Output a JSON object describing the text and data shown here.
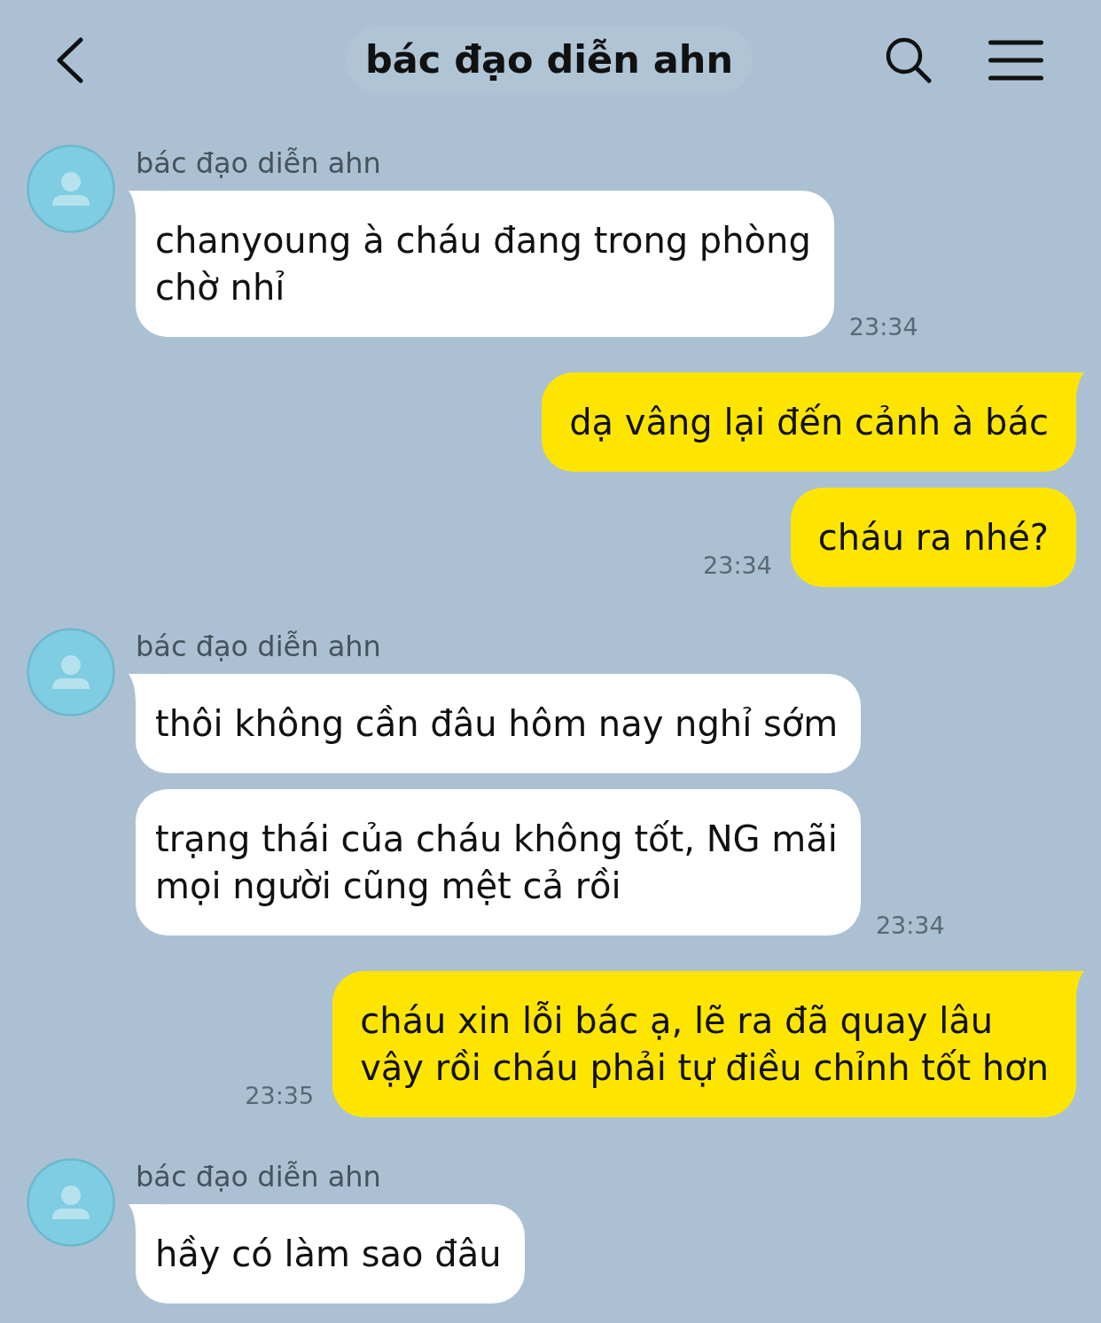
{
  "header": {
    "title": "bác đạo diễn ahn"
  },
  "messages": [
    {
      "kind": "received",
      "sender": "bác đạo diễn ahn",
      "bubbles": [
        {
          "lines": [
            "chanyoung à cháu đang trong phòng",
            "chờ nhỉ"
          ]
        }
      ],
      "time": "23:34"
    },
    {
      "kind": "sent",
      "bubbles": [
        {
          "lines": [
            "dạ vâng lại đến cảnh à bác"
          ]
        },
        {
          "lines": [
            "cháu ra nhé?"
          ]
        }
      ],
      "time": "23:34"
    },
    {
      "kind": "received",
      "sender": "bác đạo diễn ahn",
      "bubbles": [
        {
          "lines": [
            "thôi không cần đâu hôm nay nghỉ sớm"
          ]
        },
        {
          "lines": [
            "trạng thái của cháu không tốt, NG mãi",
            "mọi người cũng mệt cả rồi"
          ]
        }
      ],
      "time": "23:34"
    },
    {
      "kind": "sent",
      "bubbles": [
        {
          "lines": [
            "cháu xin lỗi bác ạ, lẽ ra đã quay lâu",
            "vậy rồi cháu phải tự điều chỉnh tốt hơn"
          ]
        }
      ],
      "time": "23:35"
    },
    {
      "kind": "received",
      "sender": "bác đạo diễn ahn",
      "bubbles": [
        {
          "lines": [
            "hầy có làm sao đâu"
          ]
        }
      ]
    }
  ]
}
